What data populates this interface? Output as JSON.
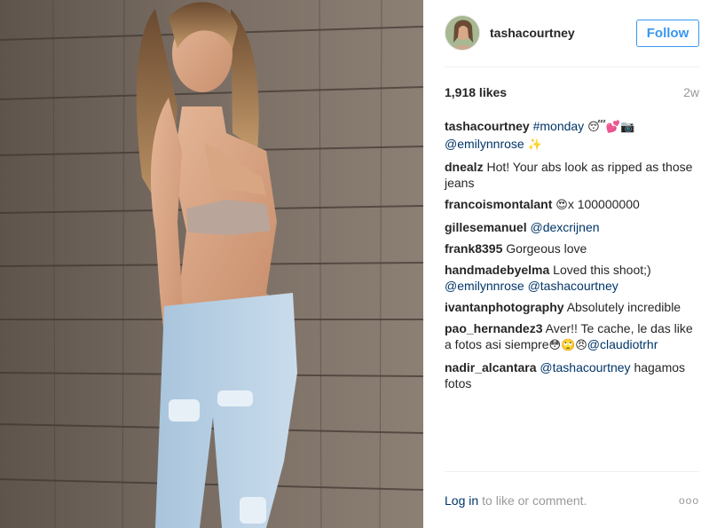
{
  "post": {
    "username": "tashacourtney",
    "follow_label": "Follow",
    "likes": "1,918 likes",
    "age": "2w"
  },
  "caption": {
    "user": "tashacourtney",
    "hashtag": "#monday",
    "emoji": "😴💕📷",
    "mention": "@emilynnrose",
    "sparkle": "✨"
  },
  "comments": [
    {
      "user": "dnealz",
      "text": "Hot! Your abs look as ripped as those jeans"
    },
    {
      "user": "francoismontalant",
      "emoji": "😍",
      "text": "x 100000000"
    },
    {
      "user": "gillesemanuel",
      "mention": "@dexcrijnen"
    },
    {
      "user": "frank8395",
      "text": "Gorgeous love"
    },
    {
      "user": "handmadebyelma",
      "text": "Loved this shoot;)",
      "mention": "@emilynnrose @tashacourtney"
    },
    {
      "user": "ivantanphotography",
      "text": "Absolutely incredible"
    },
    {
      "user": "pao_hernandez3",
      "text": "Aver!! Te cache, le das like a fotos asi siempre",
      "emoji": "😳🙄😠",
      "mention": "@claudiotrhr"
    },
    {
      "user": "nadir_alcantara",
      "mention": "@tashacourtney",
      "text": "hagamos fotos"
    }
  ],
  "footer": {
    "login": "Log in",
    "text": "to like or comment.",
    "more": "ooo"
  },
  "colors": {
    "link": "#003569",
    "follow_blue": "#3897f0",
    "muted": "#999999"
  },
  "icons": {
    "more": "more-options-icon"
  }
}
